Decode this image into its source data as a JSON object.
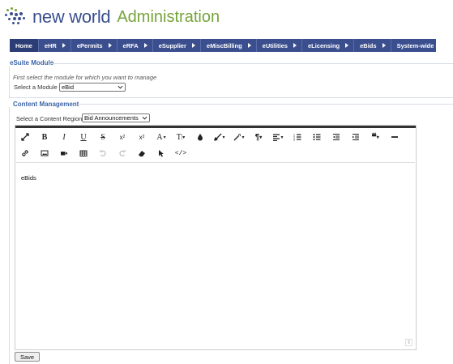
{
  "brand": {
    "name": "new world",
    "suffix": "Administration"
  },
  "nav": [
    {
      "label": "Home",
      "has_caret": false
    },
    {
      "label": "eHR",
      "has_caret": true
    },
    {
      "label": "ePermits",
      "has_caret": true
    },
    {
      "label": "eRFA",
      "has_caret": true
    },
    {
      "label": "eSupplier",
      "has_caret": true
    },
    {
      "label": "eMiscBilling",
      "has_caret": true
    },
    {
      "label": "eUtilities",
      "has_caret": true
    },
    {
      "label": "eLicensing",
      "has_caret": true
    },
    {
      "label": "eBids",
      "has_caret": true
    },
    {
      "label": "System-wide Settings",
      "has_caret": true
    }
  ],
  "esuite": {
    "title": "eSuite Module",
    "hint": "First select the module for which you want to manage",
    "module_label": "Select a Module",
    "module_value": "eBid"
  },
  "content": {
    "title": "Content Management",
    "region_label": "Select a Content Region",
    "region_value": "Bid Announcements"
  },
  "editor": {
    "body_text": "eBids",
    "toolbar_row1": [
      "fullscreen-icon",
      "bold-icon",
      "italic-icon",
      "underline-icon",
      "strikethrough-icon",
      "subscript-icon",
      "superscript-icon",
      "font-size-icon",
      "text-style-icon",
      "color-icon",
      "brush-icon",
      "magic-icon",
      "paragraph-icon",
      "align-icon",
      "ordered-list-icon",
      "unordered-list-icon",
      "outdent-icon",
      "indent-icon",
      "quote-icon",
      "horizontal-rule-icon"
    ],
    "toolbar_row2": [
      "link-icon",
      "image-icon",
      "video-icon",
      "table-icon",
      "undo-icon",
      "redo-icon",
      "eraser-icon",
      "select-icon",
      "code-view-icon"
    ]
  },
  "save_label": "Save"
}
